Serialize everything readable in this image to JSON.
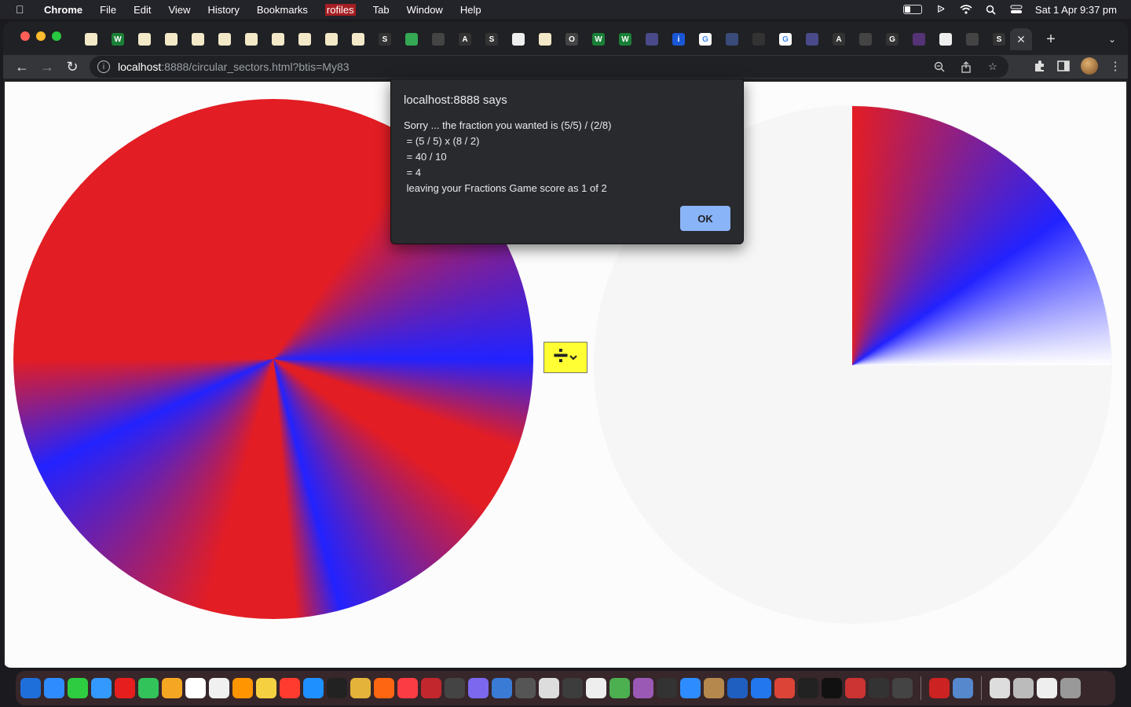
{
  "menubar": {
    "app_name": "Chrome",
    "items": [
      "File",
      "Edit",
      "View",
      "History",
      "Bookmarks",
      "rofiles",
      "Tab",
      "Window",
      "Help"
    ],
    "clock": "Sat 1 Apr  9:37 pm",
    "battery_level": 0.35
  },
  "browser": {
    "tab_favicons": [
      "page-icon",
      "w-icon",
      "page-icon",
      "page-icon",
      "page-icon",
      "page-icon",
      "page-icon",
      "page-icon",
      "page-icon",
      "page-icon",
      "page-icon",
      "s-icon",
      "maps-icon",
      "dots-icon",
      "a-icon",
      "s-icon",
      "mail-icon",
      "page-icon",
      "o-icon",
      "w-icon",
      "w-icon",
      "game-icon",
      "info-icon",
      "google-icon",
      "puzzle-icon",
      "dark-icon",
      "google-icon",
      "game-icon",
      "a-icon",
      "dots-icon",
      "g-icon",
      "loop-icon",
      "grid-icon",
      "dots-icon",
      "s-icon"
    ],
    "tab_letters": [
      "",
      "W",
      "",
      "",
      "",
      "",
      "",
      "",
      "",
      "",
      "",
      "S",
      "",
      "",
      "A",
      "S",
      "",
      "",
      "O",
      "W",
      "W",
      "",
      "i",
      "G",
      "",
      "",
      "G",
      "",
      "A",
      "",
      "G",
      "",
      "",
      "",
      "S"
    ],
    "url_host": "localhost",
    "url_rest": ":8888/circular_sectors.html?btis=My83"
  },
  "page": {
    "operator_symbol": "÷",
    "operator_value": "divide"
  },
  "dialog": {
    "title": "localhost:8888 says",
    "lines": [
      "Sorry ... the fraction you wanted is (5/5) / (2/8)",
      " = (5 / 5) x (8 / 2)",
      " = 40 / 10",
      " = 4",
      " leaving your Fractions Game score as 1 of 2"
    ],
    "ok_label": "OK"
  },
  "colors": {
    "red": "#e31d24",
    "blue": "#2222ff",
    "select_bg": "#ffff33",
    "ok_button": "#8ab4f8"
  },
  "dock_colors": [
    "#1e6fd9",
    "#2f8cff",
    "#2ecc40",
    "#3399ff",
    "#e61e1e",
    "#32c35a",
    "#f5a623",
    "#ffffff",
    "#f0f0f0",
    "#ff9500",
    "#f5d142",
    "#ff3b30",
    "#1e90ff",
    "#222222",
    "#e4b33a",
    "#ff6611",
    "#fc3c44",
    "#c1272d",
    "#444444",
    "#7b68ee",
    "#3a7bd5",
    "#555555",
    "#dddddd",
    "#3d3d3d",
    "#eeeeee",
    "#4caf50",
    "#9b59b6",
    "#333333",
    "#2d8cff",
    "#b5894d",
    "#1f5fbf",
    "#2277ee",
    "#db4437",
    "#222222",
    "#111111",
    "#cc3333",
    "#333333",
    "#444444",
    "#cc2222",
    "#5588cc",
    "#dddddd",
    "#bbbbbb",
    "#eeeeee",
    "#999999"
  ]
}
